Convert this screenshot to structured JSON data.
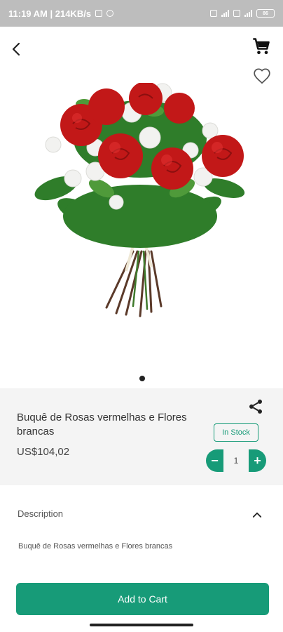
{
  "status_bar": {
    "time_speed": "11:19 AM | 214KB/s",
    "battery": "86"
  },
  "icons": {
    "back": "chevron-left-icon",
    "cart": "shopping-cart-icon",
    "favorite": "heart-outline-icon",
    "share": "share-icon",
    "expand": "chevron-up-icon"
  },
  "product": {
    "name": "Buquê de Rosas vermelhas e Flores brancas",
    "price": "US$104,02",
    "stock_status": "In Stock",
    "quantity": "1"
  },
  "description": {
    "title": "Description",
    "text": "Buquê de Rosas vermelhas e Flores brancas"
  },
  "actions": {
    "add_to_cart": "Add to Cart",
    "minus": "−",
    "plus": "+"
  },
  "colors": {
    "accent": "#179b78",
    "panel": "#f4f4f4",
    "status_bar": "#bdbdbd"
  }
}
